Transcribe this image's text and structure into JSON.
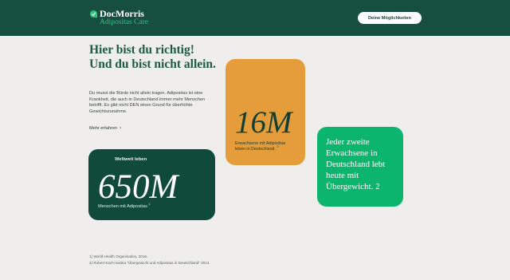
{
  "header": {
    "brand_name": "DocMorris",
    "brand_sub": "Adipositas Care",
    "cta_label": "Deine Möglichkeiten",
    "colors": {
      "bar": "#164f40",
      "accent": "#2bc37a"
    }
  },
  "hero": {
    "headline": "Hier bist du richtig! Und du bist nicht allein.",
    "intro": "Du musst die Bürde nicht allein tragen. Adipositas ist eine Krankheit, die auch in Deutschland immer mehr Menschen betrifft. Es gibt nicht DEN einen Grund für überhöhte Gewichtszunahme.",
    "more_link": "Mehr erfahren",
    "more_icon": "arrow-right-icon"
  },
  "stats": {
    "worldwide": {
      "eyebrow": "Weltweit leben",
      "value": "650M",
      "caption": "Menschen mit Adipositas",
      "ref": "1",
      "color": "#0f4a3a"
    },
    "germany": {
      "value": "16M",
      "caption": "Erwachsene mit Adipositas leben in Deutschland.",
      "ref": "2",
      "color": "#e59d3b"
    },
    "quote": {
      "text": "Jeder zweite Erwachsene in Deutschland lebt heute mit Übergewicht. 2",
      "color": "#0bb56d"
    }
  },
  "footnotes": [
    "1) World Health Organisation, 2016.",
    "2) Robert Koch-Institut \"Übergewicht und Adipositas in Deutschland\" 2013."
  ]
}
